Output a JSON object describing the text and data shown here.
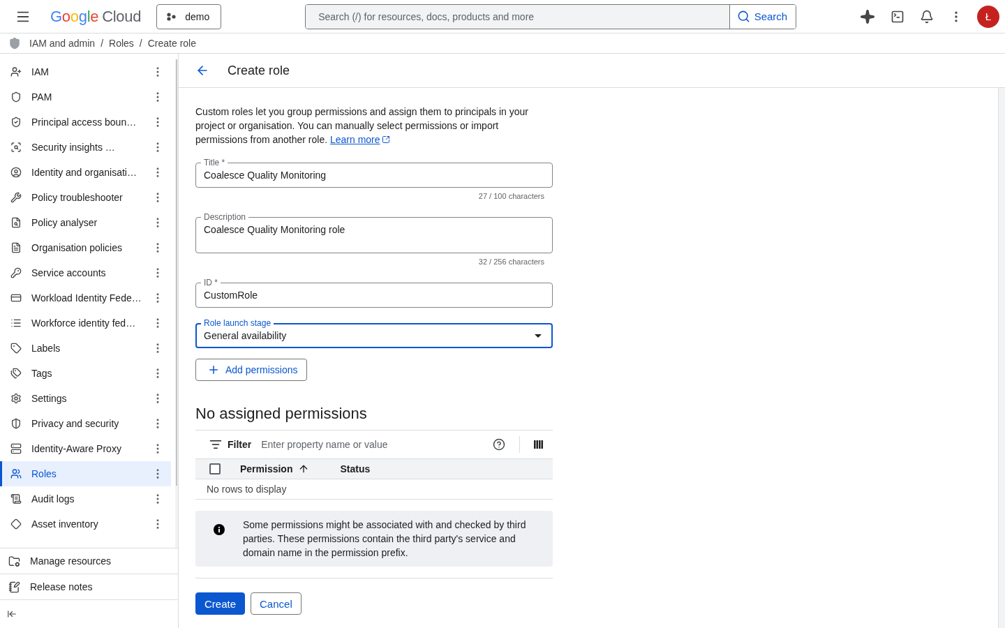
{
  "header": {
    "logo": {
      "brand": "Google",
      "product": "Cloud"
    },
    "project": "demo",
    "search": {
      "placeholder": "Search (/) for resources, docs, products and more",
      "button": "Search"
    },
    "avatar": "Ł"
  },
  "breadcrumbs": {
    "separator": "/",
    "items": [
      "IAM and admin",
      "Roles",
      "Create role"
    ]
  },
  "sidebar": {
    "items": [
      {
        "label": "IAM",
        "selected": false
      },
      {
        "label": "PAM",
        "selected": false
      },
      {
        "label": "Principal access boun…",
        "selected": false
      },
      {
        "label": "Security insights …",
        "selected": false
      },
      {
        "label": "Identity and organisati…",
        "selected": false
      },
      {
        "label": "Policy troubleshooter",
        "selected": false
      },
      {
        "label": "Policy analyser",
        "selected": false
      },
      {
        "label": "Organisation policies",
        "selected": false
      },
      {
        "label": "Service accounts",
        "selected": false
      },
      {
        "label": "Workload Identity Fede…",
        "selected": false
      },
      {
        "label": "Workforce identity fed…",
        "selected": false
      },
      {
        "label": "Labels",
        "selected": false
      },
      {
        "label": "Tags",
        "selected": false
      },
      {
        "label": "Settings",
        "selected": false
      },
      {
        "label": "Privacy and security",
        "selected": false
      },
      {
        "label": "Identity-Aware Proxy",
        "selected": false
      },
      {
        "label": "Roles",
        "selected": true
      },
      {
        "label": "Audit logs",
        "selected": false
      },
      {
        "label": "Asset inventory",
        "selected": false
      }
    ],
    "footer": [
      "Manage resources",
      "Release notes"
    ]
  },
  "page": {
    "title": "Create role",
    "intro": "Custom roles let you group permissions and assign them to principals in your project or organisation. You can manually select permissions or import permissions from another role.",
    "learn_more": "Learn more",
    "fields": [
      {
        "kind": "text",
        "label": "Title *",
        "value": "Coalesce Quality Monitoring",
        "counter": "27 / 100 characters",
        "focused": false
      },
      {
        "kind": "textarea",
        "label": "Description",
        "value": "Coalesce Quality Monitoring role",
        "counter": "32 / 256 characters",
        "focused": false
      },
      {
        "kind": "text",
        "label": "ID *",
        "value": "CustomRole",
        "focused": false
      },
      {
        "kind": "select",
        "label": "Role launch stage",
        "value": "General availability",
        "focused": true
      }
    ],
    "add_button": "Add permissions",
    "permissions": {
      "heading": "No assigned permissions",
      "filter": {
        "label": "Filter",
        "placeholder": "Enter property name or value"
      },
      "select_all_checked": false,
      "columns": [
        {
          "label": "Permission",
          "sorted": true
        },
        {
          "label": "Status",
          "sorted": false
        }
      ],
      "empty": "No rows to display"
    },
    "notice": "Some permissions might be associated with and checked by third parties. These permissions contain the third party's service and domain name in the permission prefix.",
    "actions": [
      {
        "label": "Create",
        "kind": "primary"
      },
      {
        "label": "Cancel",
        "kind": "secondary"
      }
    ]
  }
}
